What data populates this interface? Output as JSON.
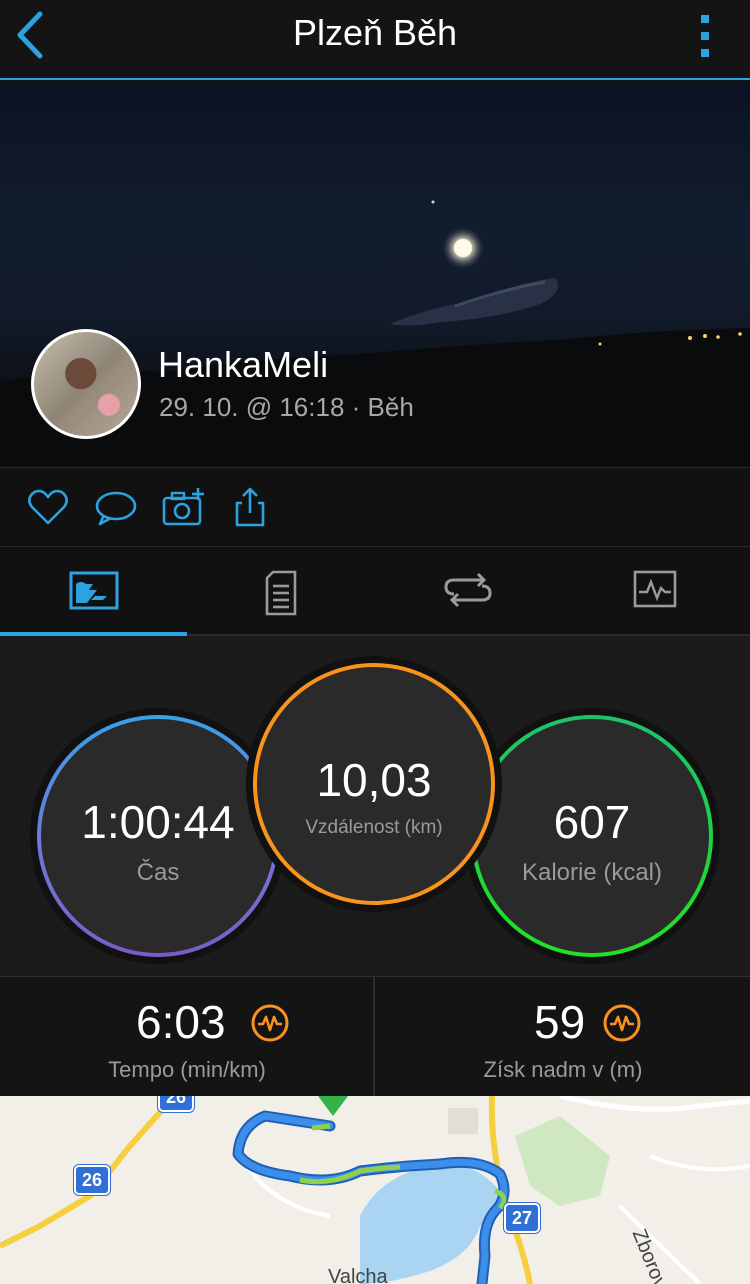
{
  "header": {
    "title": "Plzeň Běh",
    "back_icon": "chevron-left-icon",
    "more_icon": "more-vertical-icon"
  },
  "activity": {
    "user_name": "HankaMeli",
    "meta": "29. 10. @ 16:18 · Běh"
  },
  "actions": [
    {
      "icon": "heart-icon"
    },
    {
      "icon": "comment-icon"
    },
    {
      "icon": "add-photo-icon"
    },
    {
      "icon": "share-icon"
    }
  ],
  "tabs": [
    {
      "icon": "overview-icon",
      "active": true
    },
    {
      "icon": "details-list-icon",
      "active": false
    },
    {
      "icon": "laps-icon",
      "active": false
    },
    {
      "icon": "charts-icon",
      "active": false
    }
  ],
  "stats": {
    "time": {
      "value": "1:00:44",
      "label": "Čas"
    },
    "distance": {
      "value": "10,03",
      "label": "Vzdálenost (km)"
    },
    "calories": {
      "value": "607",
      "label": "Kalorie (kcal)"
    }
  },
  "metrics": {
    "pace": {
      "value": "6:03",
      "label": "Tempo (min/km)",
      "icon": "activity-graph-icon"
    },
    "elevation": {
      "value": "59",
      "label": "Získ nadm v (m)",
      "icon": "activity-graph-icon"
    }
  },
  "map": {
    "shields": [
      "26",
      "26",
      "27"
    ],
    "labels": [
      "Valcha",
      "Zborovská"
    ]
  },
  "colors": {
    "accent": "#2aa3e0",
    "time_ring_start": "#3aa0e8",
    "time_ring_end": "#7a5cc8",
    "distance_ring": "#f7931e",
    "calories_ring_start": "#1fc16b",
    "calories_ring_end": "#22e022",
    "metric_icon": "#f7931e"
  }
}
